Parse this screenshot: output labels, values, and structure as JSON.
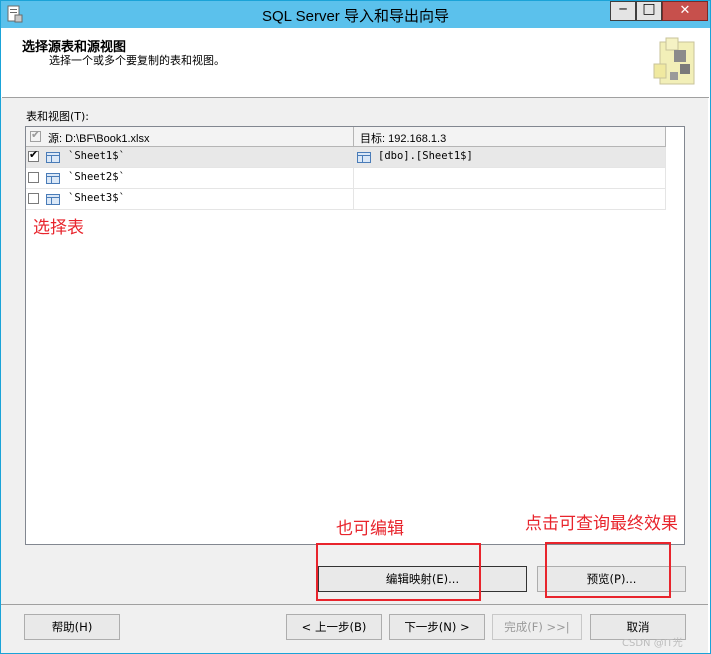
{
  "window": {
    "title": "SQL Server 导入和导出向导",
    "min_glyph": "─",
    "max_glyph": "□",
    "close_glyph": "✕"
  },
  "header": {
    "title": "选择源表和源视图",
    "subtitle": "选择一个或多个要复制的表和视图。"
  },
  "grid": {
    "label": "表和视图(T):",
    "source_header": "源: D:\\BF\\Book1.xlsx",
    "dest_header": "目标: 192.168.1.3",
    "rows": [
      {
        "source": "`Sheet1$`",
        "destination": "[dbo].[Sheet1$]",
        "checked": true
      },
      {
        "source": "`Sheet2$`",
        "destination": "",
        "checked": false
      },
      {
        "source": "`Sheet3$`",
        "destination": "",
        "checked": false
      }
    ]
  },
  "annotations": {
    "select_table": "选择表",
    "also_edit": "也可编辑",
    "preview_note": "点击可查询最终效果",
    "color": "#e8242c"
  },
  "buttons": {
    "edit_mappings": "编辑映射(E)...",
    "preview": "预览(P)...",
    "help": "帮助(H)",
    "back": "< 上一步(B)",
    "next": "下一步(N) >",
    "finish": "完成(F) >>|",
    "cancel": "取消"
  },
  "watermark": "CSDN @IT光"
}
